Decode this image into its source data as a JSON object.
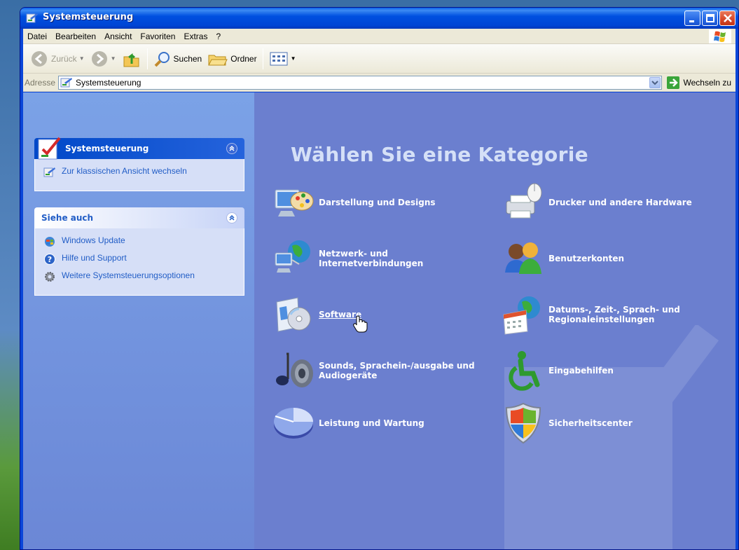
{
  "window": {
    "title": "Systemsteuerung"
  },
  "menu": [
    "Datei",
    "Bearbeiten",
    "Ansicht",
    "Favoriten",
    "Extras",
    "?"
  ],
  "toolbar": {
    "back": "Zurück",
    "search": "Suchen",
    "folders": "Ordner"
  },
  "address": {
    "label": "Adresse",
    "value": "Systemsteuerung",
    "go": "Wechseln zu"
  },
  "sidebar": {
    "panel1": {
      "title": "Systemsteuerung",
      "links": [
        "Zur klassischen Ansicht wechseln"
      ]
    },
    "panel2": {
      "title": "Siehe auch",
      "links": [
        "Windows Update",
        "Hilfe und Support",
        "Weitere Systemsteuerungsoptionen"
      ]
    }
  },
  "main": {
    "heading": "Wählen Sie eine Kategorie",
    "categories": [
      {
        "label": "Darstellung und Designs",
        "icon": "appearance-icon"
      },
      {
        "label": "Drucker und andere Hardware",
        "icon": "printer-icon"
      },
      {
        "label": "Netzwerk- und Internetverbindungen",
        "icon": "network-icon"
      },
      {
        "label": "Benutzerkonten",
        "icon": "users-icon"
      },
      {
        "label": "Software",
        "icon": "software-icon"
      },
      {
        "label": "Datums-, Zeit-, Sprach- und Regionaleinstellungen",
        "icon": "date-region-icon"
      },
      {
        "label": "Sounds, Sprachein-/ausgabe und Audiogeräte",
        "icon": "sounds-icon"
      },
      {
        "label": "Eingabehilfen",
        "icon": "accessibility-icon"
      },
      {
        "label": "Leistung und Wartung",
        "icon": "performance-icon"
      },
      {
        "label": "Sicherheitscenter",
        "icon": "security-shield-icon"
      }
    ]
  },
  "colors": {
    "titlebar": "#0050e0",
    "sidebar_link": "#215dc6",
    "main_bg": "#6b7fcf"
  }
}
